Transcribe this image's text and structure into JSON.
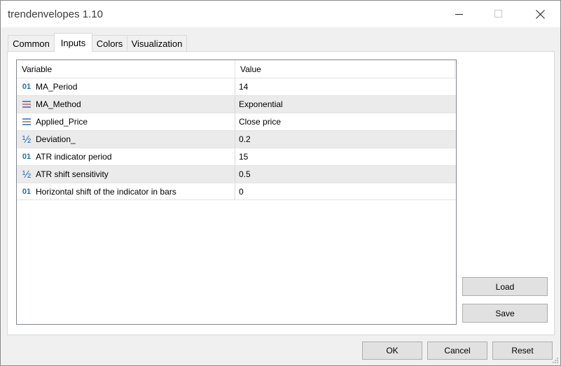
{
  "window": {
    "title": "trendenvelopes 1.10"
  },
  "tabs": [
    {
      "label": "Common",
      "active": false
    },
    {
      "label": "Inputs",
      "active": true
    },
    {
      "label": "Colors",
      "active": false
    },
    {
      "label": "Visualization",
      "active": false
    }
  ],
  "grid": {
    "headers": {
      "variable": "Variable",
      "value": "Value"
    },
    "rows": [
      {
        "icon": "integer-icon",
        "glyph": "01",
        "variable": "MA_Period",
        "value": "14"
      },
      {
        "icon": "enum-icon",
        "glyph": "",
        "variable": "MA_Method",
        "value": "Exponential"
      },
      {
        "icon": "enum-icon",
        "glyph": "",
        "variable": "Applied_Price",
        "value": "Close price"
      },
      {
        "icon": "double-icon",
        "glyph": "½",
        "variable": "Deviation_",
        "value": "0.2"
      },
      {
        "icon": "integer-icon",
        "glyph": "01",
        "variable": "ATR indicator period",
        "value": "15"
      },
      {
        "icon": "double-icon",
        "glyph": "½",
        "variable": "ATR shift sensitivity",
        "value": "0.5"
      },
      {
        "icon": "integer-icon",
        "glyph": "01",
        "variable": "Horizontal shift of the indicator in bars",
        "value": "0"
      }
    ]
  },
  "side_buttons": {
    "load": "Load",
    "save": "Save"
  },
  "footer_buttons": {
    "ok": "OK",
    "cancel": "Cancel",
    "reset": "Reset"
  },
  "colors": {
    "icon_blue": "#1e6fbf",
    "enum_red": "#d9534f"
  }
}
